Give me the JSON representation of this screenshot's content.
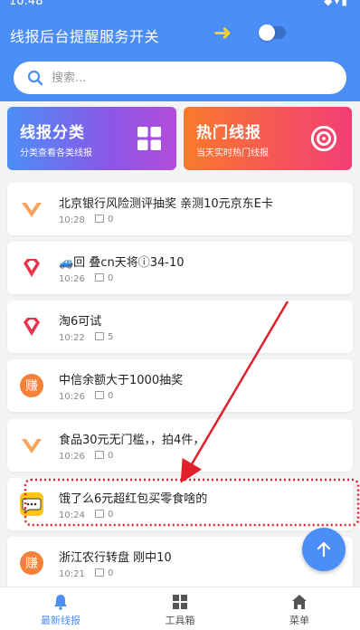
{
  "status_bar": {
    "time": "10:48",
    "icons": "◆▾▮"
  },
  "header": {
    "title": "线报后台提醒服务开关",
    "toggle_state": "off",
    "arrow_color": "#ffd21f"
  },
  "search": {
    "placeholder": "搜索..."
  },
  "cards": {
    "category": {
      "title": "线报分类",
      "subtitle": "分类查看各类线报",
      "icon": "grid-icon"
    },
    "hot": {
      "title": "热门线报",
      "subtitle": "当天实时热门线报",
      "icon": "target-icon"
    }
  },
  "feed": [
    {
      "title": "北京银行风险测评抽奖 亲测10元京东E卡",
      "time": "10:28",
      "comments": "0",
      "logo": "v-logo"
    },
    {
      "title": "🚙回 叠cn天将ⓘ34-10",
      "time": "10:26",
      "comments": "0",
      "logo": "diamond-logo"
    },
    {
      "title": "淘6可试",
      "time": "10:22",
      "comments": "5",
      "logo": "diamond-logo"
    },
    {
      "title": "中信余额大于1000抽奖",
      "time": "10:26",
      "comments": "0",
      "logo": "zhuan-logo"
    },
    {
      "title": "食品30元无门槛，，拍4件，",
      "time": "10:26",
      "comments": "0",
      "logo": "v-logo"
    },
    {
      "title": "饿了么6元超红包买零食啥的",
      "time": "10:24",
      "comments": "0",
      "logo": "chat-logo"
    },
    {
      "title": "浙江农行转盘 刚中10",
      "time": "10:21",
      "comments": "0",
      "logo": "zhuan-logo"
    }
  ],
  "bottom_nav": [
    {
      "label": "最新线报",
      "icon": "bell-icon",
      "active": true
    },
    {
      "label": "工具箱",
      "icon": "toolbox-icon",
      "active": false
    },
    {
      "label": "菜单",
      "icon": "home-icon",
      "active": false
    }
  ],
  "colors": {
    "primary": "#4c8ef7",
    "annotation": "#e0202a"
  }
}
